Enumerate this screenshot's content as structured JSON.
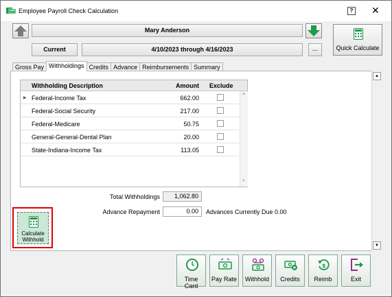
{
  "window": {
    "title": "Employee Payroll Check Calculation",
    "help_label": "?",
    "close_label": "✕"
  },
  "header": {
    "employee_name": "Mary Anderson",
    "period_label": "Current",
    "date_range": "4/10/2023 through 4/16/2023",
    "ellipsis_label": "...",
    "quick_calculate_label": "Quick Calculate"
  },
  "tabs": [
    {
      "label": "Gross Pay",
      "active": false
    },
    {
      "label": "Withholdings",
      "active": true
    },
    {
      "label": "Credits",
      "active": false
    },
    {
      "label": "Advance",
      "active": false
    },
    {
      "label": "Reimbursements",
      "active": false
    },
    {
      "label": "Summary",
      "active": false
    }
  ],
  "withholdings": {
    "columns": {
      "description": "Withholding Description",
      "amount": "Amount",
      "exclude": "Exclude"
    },
    "rows": [
      {
        "description": "Federal-Income Tax",
        "amount": "662.00",
        "exclude": false
      },
      {
        "description": "Federal-Social Security",
        "amount": "217.00",
        "exclude": false
      },
      {
        "description": "Federal-Medicare",
        "amount": "50.75",
        "exclude": false
      },
      {
        "description": "General-General-Dental Plan",
        "amount": "20.00",
        "exclude": false
      },
      {
        "description": "State-Indiana-Income Tax",
        "amount": "113.05",
        "exclude": false
      }
    ],
    "total_label": "Total Withholdings",
    "total_value": "1,062.80",
    "advance_repayment_label": "Advance Repayment",
    "advance_repayment_value": "0.00",
    "advances_due_text": "Advances Currently Due 0.00"
  },
  "calculate_withhold": {
    "line1": "Calculate",
    "line2": "Withhold"
  },
  "bottom_buttons": [
    {
      "label": "Time Card",
      "icon": "clock-icon"
    },
    {
      "label": "Pay Rate",
      "icon": "pay-rate-icon"
    },
    {
      "label": "Withhold",
      "icon": "withhold-icon"
    },
    {
      "label": "Credits",
      "icon": "credits-icon"
    },
    {
      "label": "Reimb",
      "icon": "reimb-icon"
    },
    {
      "label": "Exit",
      "icon": "exit-icon"
    }
  ],
  "colors": {
    "accent_green": "#1f9a4a",
    "highlight_red": "#e00000",
    "calc_button_bg": "#cbe8d7",
    "exit_purple": "#9b2a8d"
  }
}
